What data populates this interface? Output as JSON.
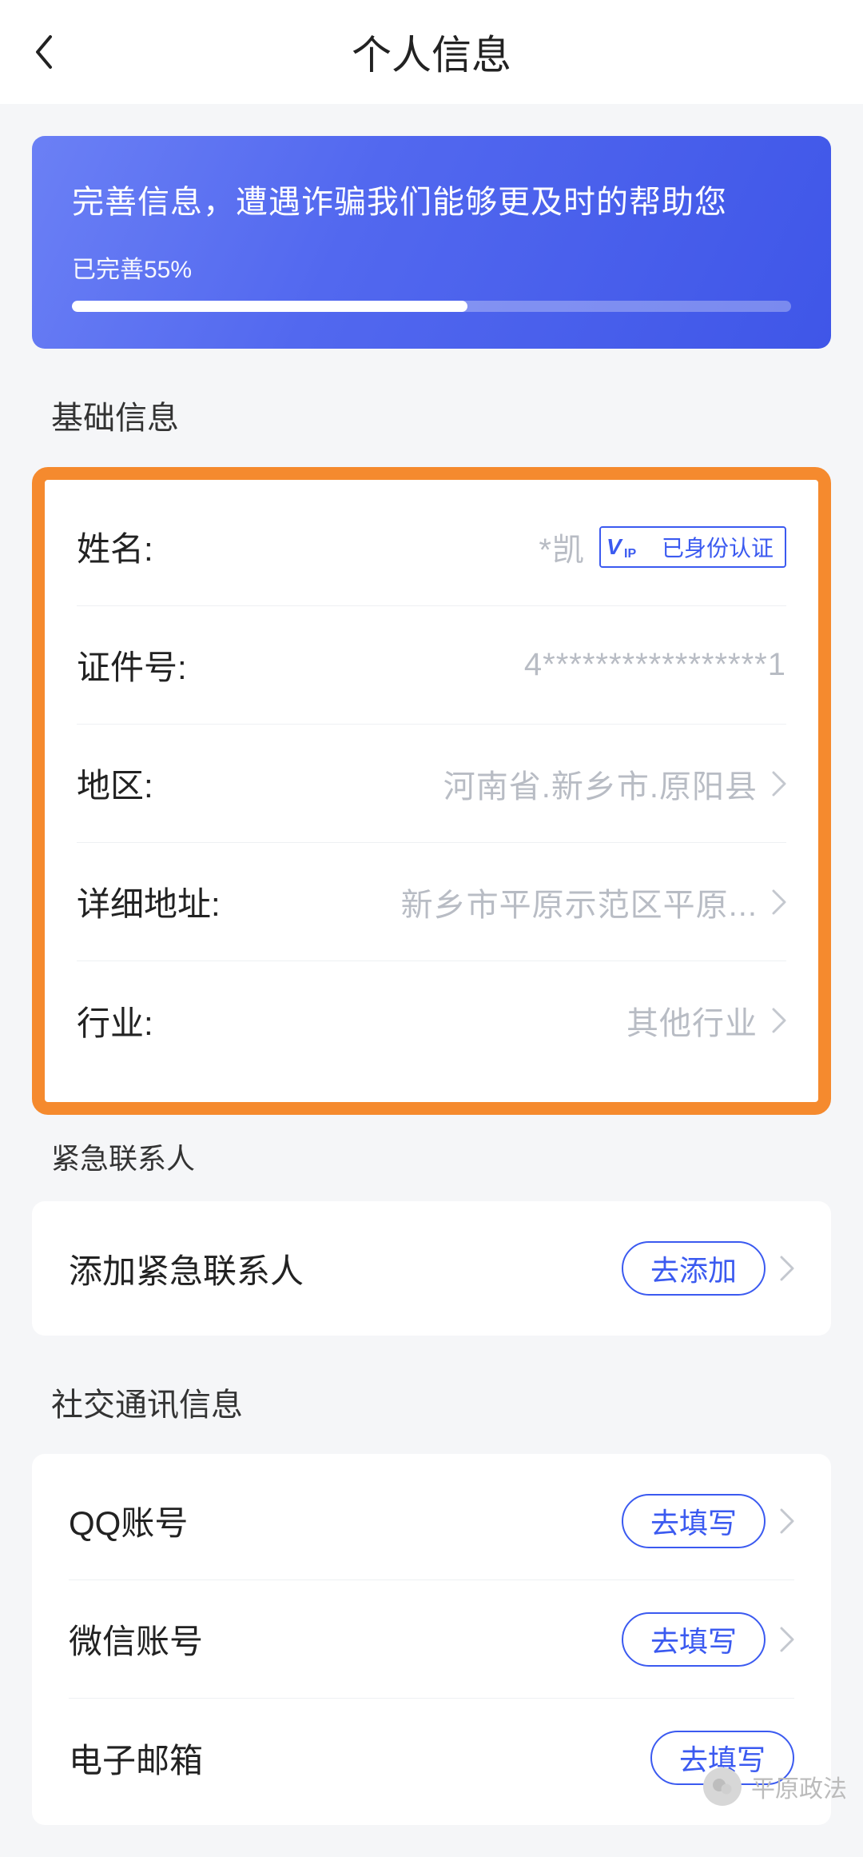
{
  "header": {
    "title": "个人信息"
  },
  "banner": {
    "title": "完善信息，遭遇诈骗我们能够更及时的帮助您",
    "sub": "已完善55%",
    "progress": 55
  },
  "sections": {
    "basic_title": "基础信息",
    "emergency_title": "紧急联系人",
    "social_title": "社交通讯信息"
  },
  "basic": {
    "name_label": "姓名:",
    "name_value": "*凯",
    "name_verified_text": "已身份认证",
    "id_label": "证件号:",
    "id_value": "4*****************1",
    "region_label": "地区:",
    "region_value": "河南省.新乡市.原阳县",
    "address_label": "详细地址:",
    "address_value": "新乡市平原示范区平原...",
    "industry_label": "行业:",
    "industry_value": "其他行业"
  },
  "emergency": {
    "add_contact_label": "添加紧急联系人",
    "add_contact_btn": "去添加"
  },
  "social": {
    "qq_label": "QQ账号",
    "qq_btn": "去填写",
    "wechat_label": "微信账号",
    "wechat_btn": "去填写",
    "email_label": "电子邮箱",
    "email_btn": "去填写"
  },
  "watermark": "平原政法"
}
